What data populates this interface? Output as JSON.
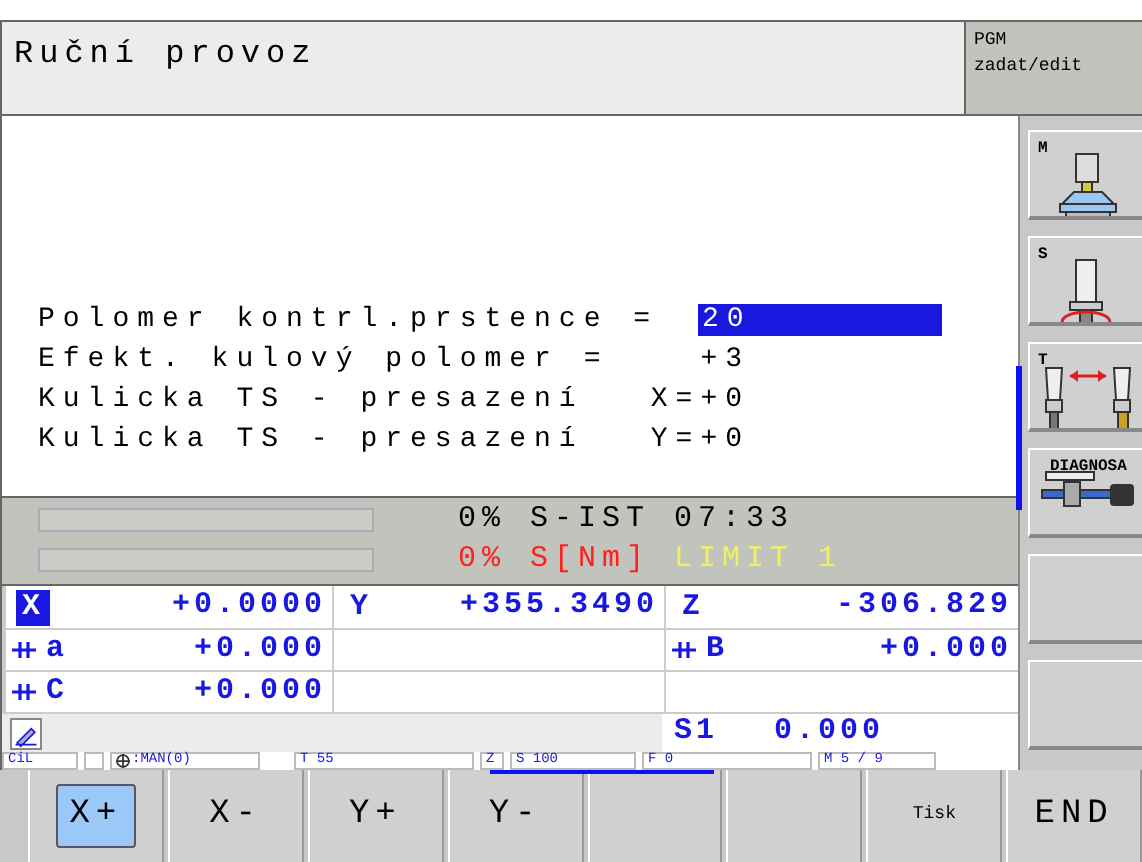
{
  "header": {
    "title": "Ruční provoz",
    "mode": [
      "PGM",
      "zadat/edit"
    ]
  },
  "dialog": [
    {
      "kind": "input",
      "label": "Polomer kontrl.prstence =",
      "value": "20",
      "selected": true
    },
    {
      "kind": "text",
      "label": "Efekt. kulový polomer =",
      "value": "+3"
    },
    {
      "kind": "text",
      "label": "Kulicka TS - presazení",
      "value": "X=+0"
    },
    {
      "kind": "text",
      "label": "Kulicka TS - presazení",
      "value": "Y=+0"
    }
  ],
  "gauges": [
    {
      "parts": [
        {
          "text": "0%",
          "color": "#000000"
        },
        {
          "text": "S-IST",
          "color": "#000000"
        },
        {
          "text": "07:33",
          "color": "#000000"
        }
      ]
    },
    {
      "parts": [
        {
          "text": "0%",
          "color": "#ff2020"
        },
        {
          "text": "S[Nm]",
          "color": "#ff2020"
        },
        {
          "text": "LIMIT 1",
          "color": "#f0f060"
        }
      ]
    }
  ],
  "positions": [
    [
      {
        "kind": "axis",
        "axis": "X",
        "value": "+0.0000",
        "selected": true,
        "clamped": false
      },
      {
        "kind": "axis",
        "axis": "Y",
        "value": "+355.3490",
        "selected": false,
        "clamped": false
      },
      {
        "kind": "axis",
        "axis": "Z",
        "value": "-306.829",
        "selected": false,
        "clamped": false
      }
    ],
    [
      {
        "kind": "axis",
        "axis": "a",
        "value": "+0.000",
        "selected": false,
        "clamped": true
      },
      {
        "kind": "empty"
      },
      {
        "kind": "axis",
        "axis": "B",
        "value": "+0.000",
        "selected": false,
        "clamped": true
      }
    ],
    [
      {
        "kind": "axis",
        "axis": "C",
        "value": "+0.000",
        "selected": false,
        "clamped": true
      },
      {
        "kind": "empty"
      },
      {
        "kind": "empty"
      }
    ]
  ],
  "spindle": {
    "label": "S1",
    "value": "0.000"
  },
  "status": [
    {
      "kind": "text",
      "text": "CiL"
    },
    {
      "kind": "blank"
    },
    {
      "kind": "datum",
      "text": ":MAN(0)"
    },
    {
      "kind": "text",
      "text": "T 55"
    },
    {
      "kind": "text",
      "text": "Z"
    },
    {
      "kind": "text",
      "text": "S 100"
    },
    {
      "kind": "text",
      "text": "F 0"
    },
    {
      "kind": "text",
      "text": "M 5 / 9"
    }
  ],
  "side_softkeys": [
    {
      "kind": "machine",
      "label": "M"
    },
    {
      "kind": "spindle",
      "label": "S"
    },
    {
      "kind": "tool",
      "label": "T"
    },
    {
      "kind": "diagnosis",
      "label": "DIAGNOSA"
    },
    {
      "kind": "empty"
    },
    {
      "kind": "empty"
    }
  ],
  "softkeys": [
    {
      "kind": "large",
      "label": "X+",
      "selected": true
    },
    {
      "kind": "large",
      "label": "X-",
      "selected": false
    },
    {
      "kind": "large",
      "label": "Y+",
      "selected": false
    },
    {
      "kind": "large",
      "label": "Y-",
      "selected": false
    },
    {
      "kind": "empty"
    },
    {
      "kind": "empty"
    },
    {
      "kind": "small",
      "label": "Tisk",
      "selected": false
    },
    {
      "kind": "large",
      "label": "END",
      "selected": false
    }
  ]
}
